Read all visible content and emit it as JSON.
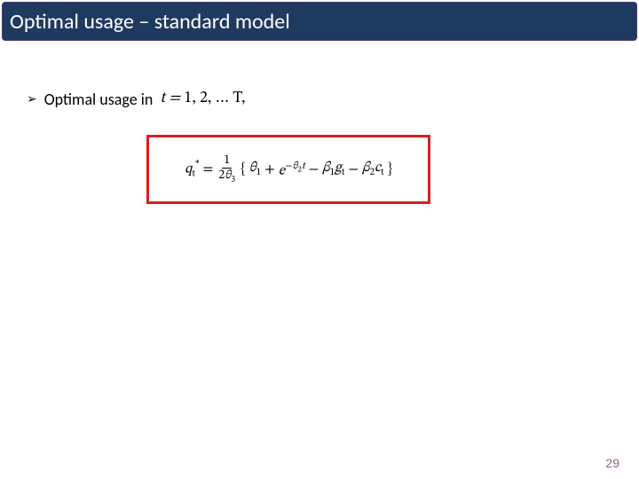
{
  "title": "Optimal usage – standard model",
  "bullet": {
    "symbol": "➢",
    "text": "Optimal usage in"
  },
  "bullet_math": {
    "var": "t",
    "eq": " = ",
    "range": "1, 2, … T,"
  },
  "equation": {
    "lhs_var": "q",
    "lhs_sub": "t",
    "lhs_sup": "*",
    "eq": "=",
    "frac_num": "1",
    "frac_den_coef": "2",
    "frac_den_sym": "θ",
    "frac_den_sub": "3",
    "lbrace": "{",
    "t1_sym": "θ",
    "t1_sub": "1",
    "plus": " + ",
    "e_base": "e",
    "e_exp_neg": "−",
    "e_exp_sym": "θ",
    "e_exp_sub": "2",
    "e_exp_var": "t",
    "minus1": " − ",
    "b1_sym": "β",
    "b1_sub": "1",
    "g_sym": "g",
    "g_sub": "t",
    "minus2": " − ",
    "b2_sym": "β",
    "b2_sub": "2",
    "c_sym": "c",
    "c_sub": "t",
    "rbrace": "}"
  },
  "page_number": "29"
}
